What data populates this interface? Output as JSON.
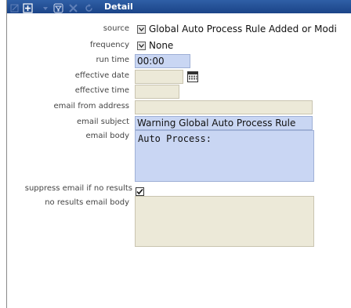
{
  "panel": {
    "title": "Detail"
  },
  "toolbar": {
    "icons": [
      "edit-icon",
      "add-icon",
      "filter-icon",
      "delete-icon",
      "refresh-icon"
    ]
  },
  "form": {
    "source_label": "source",
    "source_value": "Global Auto Process Rule Added or Modi",
    "frequency_label": "frequency",
    "frequency_value": "None",
    "run_time_label": "run time",
    "run_time_value": "00:00",
    "effective_date_label": "effective date",
    "effective_date_value": "",
    "effective_time_label": "effective time",
    "effective_time_value": "",
    "email_from_label": "email from address",
    "email_from_value": "",
    "email_subject_label": "email subject",
    "email_subject_value": "Warning Global Auto Process Rule",
    "email_body_label": "email body",
    "email_body_value": "Auto Process:",
    "suppress_label": "suppress email if no results",
    "suppress_checked": true,
    "no_results_label": "no results email body",
    "no_results_value": ""
  }
}
